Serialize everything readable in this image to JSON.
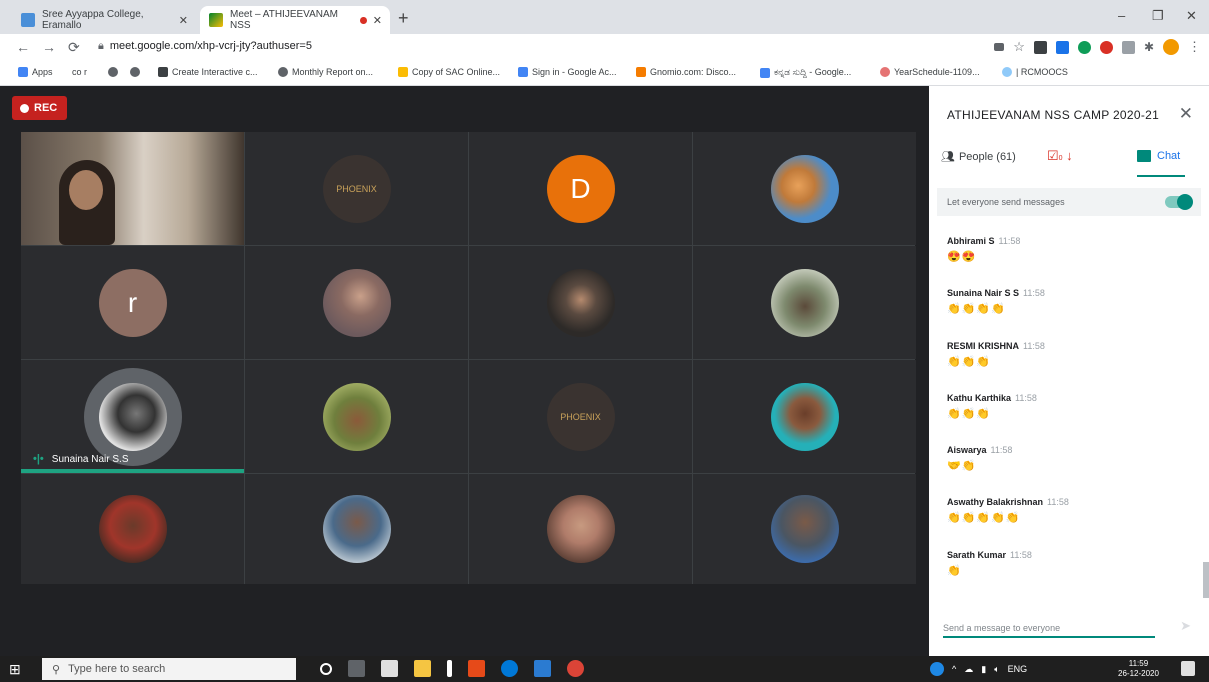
{
  "browser": {
    "tabs": [
      {
        "title": "Sree Ayyappa College, Eramallo",
        "active": false,
        "icon": "school-site-icon"
      },
      {
        "title": "Meet – ATHIJEEVANAM NSS",
        "active": true,
        "icon": "google-meet-icon"
      }
    ],
    "new_tab": "+",
    "window_controls": {
      "minimize": "–",
      "maximize": "❐",
      "close": "✕"
    },
    "address": "meet.google.com/xhp-vcrj-jty?authuser=5",
    "bookmarks": [
      "Apps",
      "co r",
      "Create Interactive c...",
      "Monthly Report on...",
      "Copy of SAC Online...",
      "Sign in - Google Ac...",
      "Gnomio.com: Disco...",
      "ಕನ್ನಡ ಸುದ್ದಿ - Google...",
      "YearSchedule-1109...",
      "| RCMOOCS"
    ]
  },
  "meeting": {
    "recording_label": "REC",
    "participants": [
      {
        "type": "video"
      },
      {
        "type": "avatar",
        "color": "#3a3330",
        "letter": ""
      },
      {
        "type": "avatar",
        "color": "#e8710a",
        "letter": "D"
      },
      {
        "type": "avatar",
        "color": "#4c8cc9",
        "letter": ""
      },
      {
        "type": "avatar",
        "color": "#8d6e63",
        "letter": "r"
      },
      {
        "type": "avatar",
        "color": "#6d5a5d",
        "letter": ""
      },
      {
        "type": "avatar",
        "color": "#2d2a28",
        "letter": ""
      },
      {
        "type": "avatar",
        "color": "#7e8a6e",
        "letter": ""
      },
      {
        "type": "avatar",
        "color": "#cfcfcf",
        "letter": "",
        "speaking": true,
        "name": "Sunaina Nair S.S"
      },
      {
        "type": "avatar",
        "color": "#6f7f3d",
        "letter": ""
      },
      {
        "type": "avatar",
        "color": "#3a3330",
        "letter": ""
      },
      {
        "type": "avatar",
        "color": "#25b0b8",
        "letter": ""
      },
      {
        "type": "avatar",
        "color": "#a0352a",
        "letter": ""
      },
      {
        "type": "avatar",
        "color": "#7f8f9c",
        "letter": ""
      },
      {
        "type": "avatar",
        "color": "#b07c6a",
        "letter": ""
      },
      {
        "type": "avatar",
        "color": "#4a5663",
        "letter": ""
      }
    ]
  },
  "panel": {
    "title": "ATHIJEEVANAM NSS CAMP 2020-21",
    "people_label": "People (61)",
    "chat_label": "Chat",
    "toggle_label": "Let everyone send messages",
    "messages": [
      {
        "sender": "Abhirami S",
        "time": "11:58",
        "emoji": "😍😍"
      },
      {
        "sender": "Sunaina Nair S S",
        "time": "11:58",
        "emoji": "👏👏👏👏"
      },
      {
        "sender": "RESMI KRISHNA",
        "time": "11:58",
        "emoji": "👏👏👏"
      },
      {
        "sender": "Kathu Karthika",
        "time": "11:58",
        "emoji": "👏👏👏"
      },
      {
        "sender": "Aiswarya",
        "time": "11:58",
        "emoji": "🤝👏"
      },
      {
        "sender": "Aswathy Balakrishnan",
        "time": "11:58",
        "emoji": "👏👏👏👏👏"
      },
      {
        "sender": "Sarath Kumar",
        "time": "11:58",
        "emoji": "👏"
      }
    ],
    "compose_placeholder": "Send a message to everyone"
  },
  "taskbar": {
    "search_placeholder": "Type here to search",
    "clock_time": "11:59",
    "clock_date": "26-12-2020",
    "language": "ENG"
  }
}
